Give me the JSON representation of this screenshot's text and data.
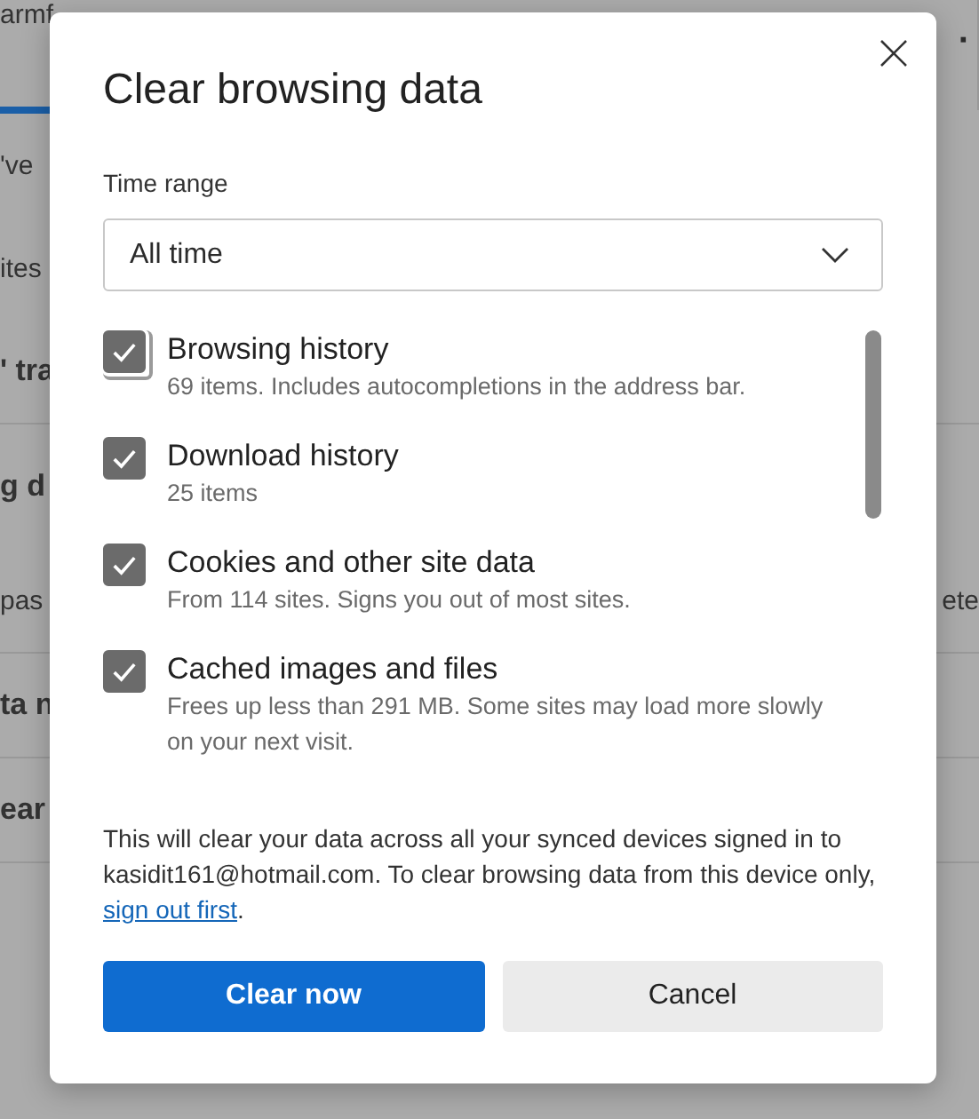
{
  "background": {
    "top_left": "armf",
    "top_more": "·",
    "rows": [
      {
        "left": "'ve",
        "heading": false,
        "rule_below": false
      },
      {
        "left": "ites",
        "heading": false,
        "rule_below": false
      },
      {
        "left": "' tra",
        "heading": true,
        "rule_below": true
      },
      {
        "left": "g d",
        "heading": true,
        "rule_below": false
      },
      {
        "left": "pas",
        "right": "ete",
        "heading": false,
        "rule_below": true
      },
      {
        "left": "ta n",
        "heading": true,
        "rule_below": true
      },
      {
        "left": "ear",
        "heading": true,
        "rule_below": true
      }
    ]
  },
  "dialog": {
    "title": "Clear browsing data",
    "time_range": {
      "label": "Time range",
      "value": "All time"
    },
    "items": [
      {
        "label": "Browsing history",
        "description": "69 items. Includes autocompletions in the address bar.",
        "checked": true,
        "focused": true
      },
      {
        "label": "Download history",
        "description": "25 items",
        "checked": true,
        "focused": false
      },
      {
        "label": "Cookies and other site data",
        "description": "From 114 sites. Signs you out of most sites.",
        "checked": true,
        "focused": false
      },
      {
        "label": "Cached images and files",
        "description": "Frees up less than 291 MB. Some sites may load more slowly on your next visit.",
        "checked": true,
        "focused": false
      }
    ],
    "note": "This will clear your data across all your synced devices signed in to kasidit161@hotmail.com. To clear browsing data from this device only,",
    "note_link": "sign out first",
    "note_end": ".",
    "buttons": [
      {
        "label": "Clear now",
        "kind": "primary"
      },
      {
        "label": "Cancel",
        "kind": "secondary"
      }
    ]
  }
}
